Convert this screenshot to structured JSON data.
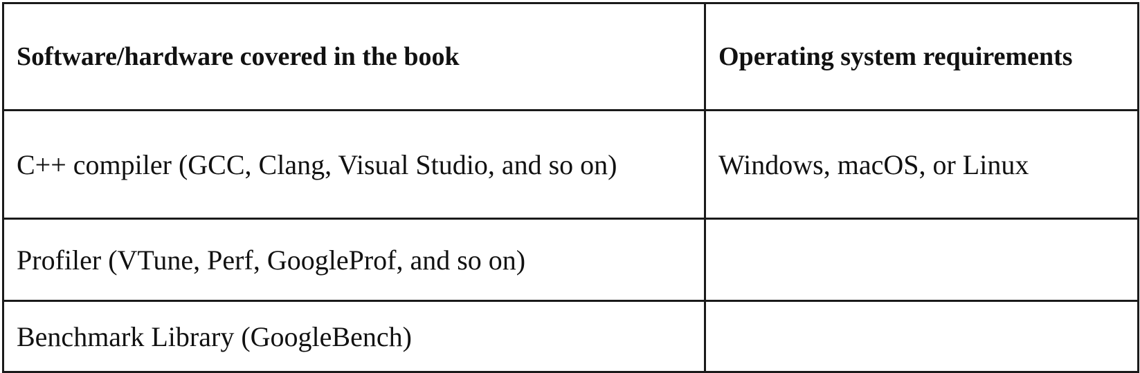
{
  "table": {
    "headers": [
      "Software/hardware covered in the book",
      "Operating system requirements"
    ],
    "rows": [
      [
        "C++ compiler (GCC, Clang, Visual Studio, and so on)",
        "Windows, macOS, or Linux"
      ],
      [
        "Profiler (VTune, Perf, GoogleProf, and so on)",
        ""
      ],
      [
        "Benchmark Library (GoogleBench)",
        ""
      ]
    ]
  }
}
